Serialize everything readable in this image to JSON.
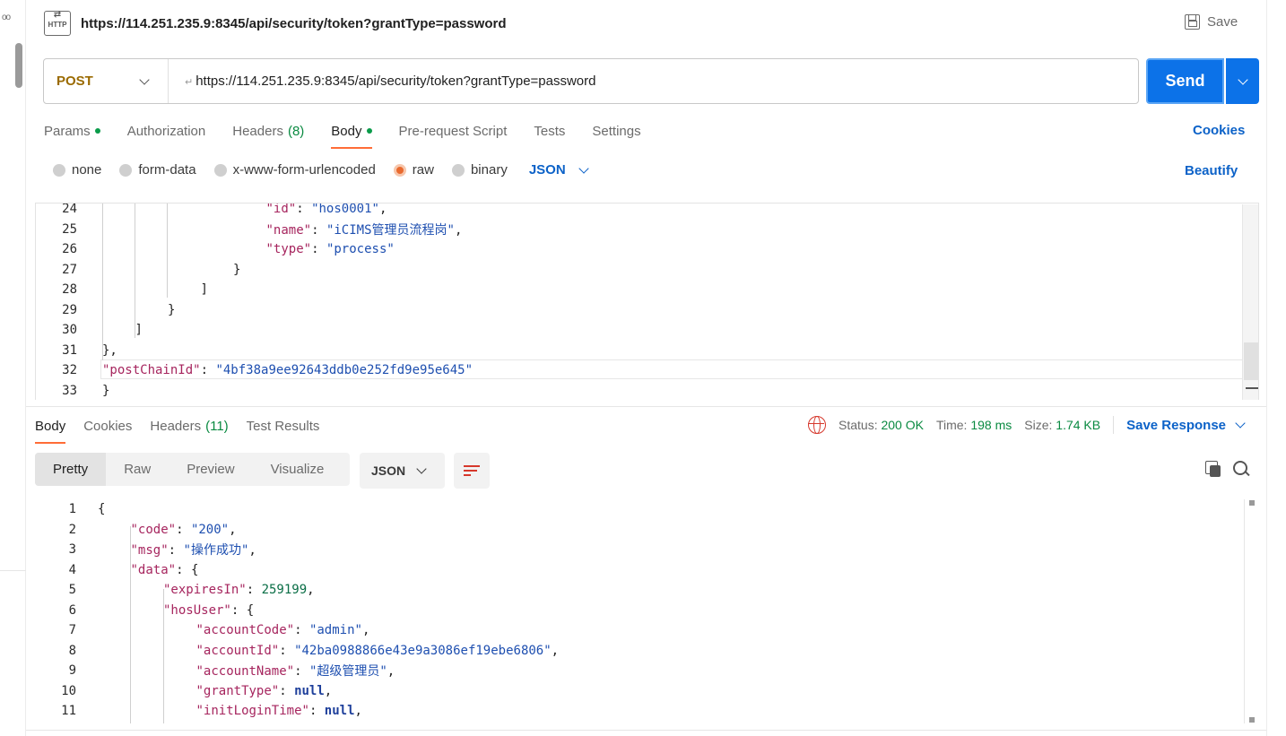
{
  "request": {
    "title": "https://114.251.235.9:8345/api/security/token?grantType=password",
    "save_label": "Save",
    "method": "POST",
    "url": "https://114.251.235.9:8345/api/security/token?grantType=password",
    "send_label": "Send"
  },
  "request_tabs": [
    {
      "label": "Params",
      "dot": true
    },
    {
      "label": "Authorization"
    },
    {
      "label": "Headers",
      "count": "(8)"
    },
    {
      "label": "Body",
      "dot": true,
      "active": true
    },
    {
      "label": "Pre-request Script"
    },
    {
      "label": "Tests"
    },
    {
      "label": "Settings"
    }
  ],
  "cookies_label": "Cookies",
  "body_types": {
    "options": [
      "none",
      "form-data",
      "x-www-form-urlencoded",
      "raw",
      "binary"
    ],
    "selected": "raw",
    "format": "JSON",
    "beautify_label": "Beautify"
  },
  "request_body_lines": [
    {
      "n": "24",
      "indent": 5,
      "key": "\"id\"",
      "val": "\"hos0001\"",
      "end": ","
    },
    {
      "n": "25",
      "indent": 5,
      "key": "\"name\"",
      "val": "\"iCIMS管理员流程岗\"",
      "end": ","
    },
    {
      "n": "26",
      "indent": 5,
      "key": "\"type\"",
      "val": "\"process\"",
      "end": ""
    },
    {
      "n": "27",
      "indent": 4,
      "text": "}"
    },
    {
      "n": "28",
      "indent": 3,
      "text": "]"
    },
    {
      "n": "29",
      "indent": 2,
      "text": "}"
    },
    {
      "n": "30",
      "indent": 1,
      "text": "]"
    },
    {
      "n": "31",
      "indent": 0,
      "text": "},"
    },
    {
      "n": "32",
      "indent": 0,
      "key": "\"postChainId\"",
      "val": "\"4bf38a9ee92643ddb0e252fd9e95e645\"",
      "end": ""
    },
    {
      "n": "33",
      "indent": 0,
      "text": "}"
    }
  ],
  "response_tabs": [
    {
      "label": "Body",
      "active": true
    },
    {
      "label": "Cookies"
    },
    {
      "label": "Headers",
      "count": "(11)"
    },
    {
      "label": "Test Results"
    }
  ],
  "status": {
    "status_label": "Status:",
    "status_value": "200 OK",
    "time_label": "Time:",
    "time_value": "198 ms",
    "size_label": "Size:",
    "size_value": "1.74 KB",
    "save_response_label": "Save Response"
  },
  "response_views": [
    "Pretty",
    "Raw",
    "Preview",
    "Visualize"
  ],
  "response_format": "JSON",
  "response_lines": [
    {
      "n": "1",
      "indent": 0,
      "text": "{"
    },
    {
      "n": "2",
      "indent": 1,
      "key": "\"code\"",
      "val": "\"200\"",
      "end": ","
    },
    {
      "n": "3",
      "indent": 1,
      "key": "\"msg\"",
      "val": "\"操作成功\"",
      "end": ","
    },
    {
      "n": "4",
      "indent": 1,
      "key": "\"data\"",
      "open": "{"
    },
    {
      "n": "5",
      "indent": 2,
      "key": "\"expiresIn\"",
      "num": "259199",
      "end": ","
    },
    {
      "n": "6",
      "indent": 2,
      "key": "\"hosUser\"",
      "open": "{"
    },
    {
      "n": "7",
      "indent": 3,
      "key": "\"accountCode\"",
      "val": "\"admin\"",
      "end": ","
    },
    {
      "n": "8",
      "indent": 3,
      "key": "\"accountId\"",
      "val": "\"42ba0988866e43e9a3086ef19ebe6806\"",
      "end": ","
    },
    {
      "n": "9",
      "indent": 3,
      "key": "\"accountName\"",
      "val": "\"超级管理员\"",
      "end": ","
    },
    {
      "n": "10",
      "indent": 3,
      "key": "\"grantType\"",
      "kw": "null",
      "end": ","
    },
    {
      "n": "11",
      "indent": 3,
      "key": "\"initLoginTime\"",
      "kw": "null",
      "end": ","
    }
  ],
  "colors": {
    "send": "#0c72e8",
    "accent_tab": "#ff6c37",
    "link": "#0c62c8",
    "method": "#9a6a00",
    "json_key": "#a6255e",
    "json_string": "#1e4fb0",
    "json_number": "#0a6e46"
  }
}
